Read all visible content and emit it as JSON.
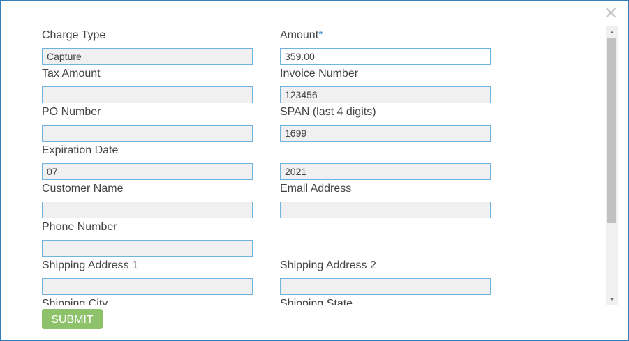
{
  "dialog": {
    "close_icon": "close-icon",
    "submit_label": "SUBMIT"
  },
  "fields": {
    "charge_type": {
      "label": "Charge Type",
      "value": "Capture"
    },
    "amount": {
      "label": "Amount",
      "required_mark": "*",
      "value": "359.00"
    },
    "tax_amount": {
      "label": "Tax Amount",
      "value": ""
    },
    "invoice_number": {
      "label": "Invoice Number",
      "value": "123456"
    },
    "po_number": {
      "label": "PO Number",
      "value": ""
    },
    "span": {
      "label": "SPAN (last 4 digits)",
      "value": "1699"
    },
    "expiration_date": {
      "label": "Expiration Date",
      "month": "07",
      "year": "2021"
    },
    "customer_name": {
      "label": "Customer Name",
      "value": ""
    },
    "email_address": {
      "label": "Email Address",
      "value": ""
    },
    "phone_number": {
      "label": "Phone Number",
      "value": ""
    },
    "shipping_address_1": {
      "label": "Shipping Address 1",
      "value": ""
    },
    "shipping_address_2": {
      "label": "Shipping Address 2",
      "value": ""
    },
    "shipping_city": {
      "label": "Shipping City"
    },
    "shipping_state": {
      "label": "Shipping State"
    }
  },
  "scrollbar": {
    "up_arrow": "▲",
    "down_arrow": "▼"
  }
}
